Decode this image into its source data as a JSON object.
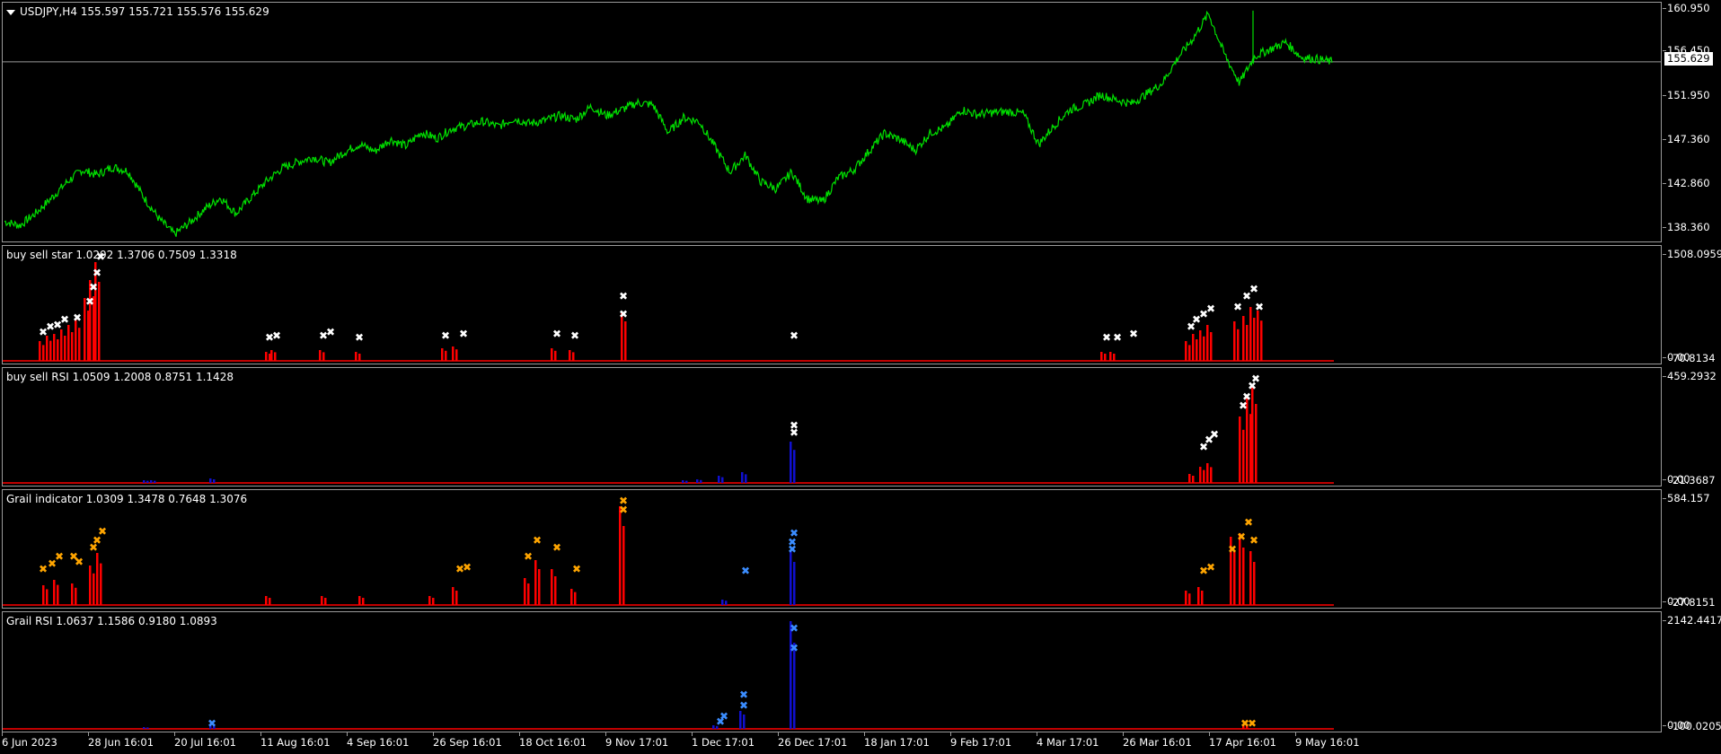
{
  "main": {
    "title": "USDJPY,H4  155.597 155.721 155.576 155.629",
    "current_price": "155.629",
    "price_line_level": 155.629,
    "ylim": [
      137.3,
      161.6
    ],
    "ticks": [
      "160.950",
      "156.450",
      "151.950",
      "147.360",
      "142.860",
      "138.360"
    ],
    "line_color": "#00e000"
  },
  "indicators": [
    {
      "title": "buy sell star 1.0292 1.3706 0.7509 1.3318",
      "top_tick": "1508.0959",
      "bottom_tick": "0.00",
      "bottom_tick2": "70.8134"
    },
    {
      "title": "buy sell RSI 1.0509 1.2008 0.8751 1.1428",
      "top_tick": "459.2932",
      "bottom_tick": "0.00",
      "bottom_tick2": "21.3687"
    },
    {
      "title": "Grail indicator 1.0309 1.3478 0.7648 1.3076",
      "top_tick": "584.157",
      "bottom_tick": "0.00",
      "bottom_tick2": "27.8151"
    },
    {
      "title": "Grail RSI 1.0637 1.1586 0.9180 1.0893",
      "top_tick": "2142.4417",
      "bottom_tick": "0.00",
      "bottom_tick2": "100.0205"
    }
  ],
  "time_labels": [
    "6 Jun 2023",
    "28 Jun 16:01",
    "20 Jul 16:01",
    "11 Aug 16:01",
    "4 Sep 16:01",
    "26 Sep 16:01",
    "18 Oct 16:01",
    "9 Nov 17:01",
    "1 Dec 17:01",
    "26 Dec 17:01",
    "18 Jan 17:01",
    "9 Feb 17:01",
    "4 Mar 17:01",
    "26 Mar 16:01",
    "17 Apr 16:01",
    "9 May 16:01"
  ],
  "colors": {
    "bear_bar": "#ff0000",
    "bull_bar": "#1010d0",
    "star_marker": "#ffffff",
    "grail_marker": "#ffa500",
    "blue_marker": "#3b8dff",
    "baseline": "#ff0000"
  },
  "chart_data": {
    "type": "line",
    "title": "USDJPY,H4",
    "x_start": "6 Jun 2023",
    "x_end": "9 May 16:01",
    "series": [
      {
        "name": "USDJPY",
        "values": [
          139.5,
          139.1,
          140.3,
          141.8,
          143.4,
          144.7,
          144.2,
          145.0,
          144.6,
          142.0,
          139.8,
          138.2,
          139.4,
          140.8,
          141.9,
          140.3,
          142.0,
          143.6,
          144.9,
          145.5,
          146.0,
          145.4,
          146.5,
          147.3,
          146.6,
          147.8,
          147.1,
          148.5,
          147.9,
          148.9,
          149.2,
          149.6,
          149.1,
          149.9,
          149.4,
          149.7,
          150.2,
          149.8,
          151.1,
          150.2,
          150.8,
          151.5,
          151.3,
          148.5,
          150.0,
          149.6,
          147.1,
          144.5,
          146.2,
          143.5,
          142.8,
          144.5,
          141.8,
          141.5,
          143.9,
          144.7,
          146.6,
          148.4,
          147.8,
          146.7,
          148.5,
          149.0,
          150.8,
          150.3,
          150.5,
          150.6,
          150.4,
          147.3,
          149.2,
          150.8,
          151.3,
          152.3,
          151.8,
          151.4,
          152.4,
          153.5,
          156.0,
          158.0,
          160.5,
          156.5,
          153.5,
          156.2,
          156.9,
          157.6,
          156.1,
          155.9,
          155.63
        ]
      }
    ],
    "ylim": [
      137.3,
      161.6
    ],
    "grid": false,
    "legend": "none"
  }
}
